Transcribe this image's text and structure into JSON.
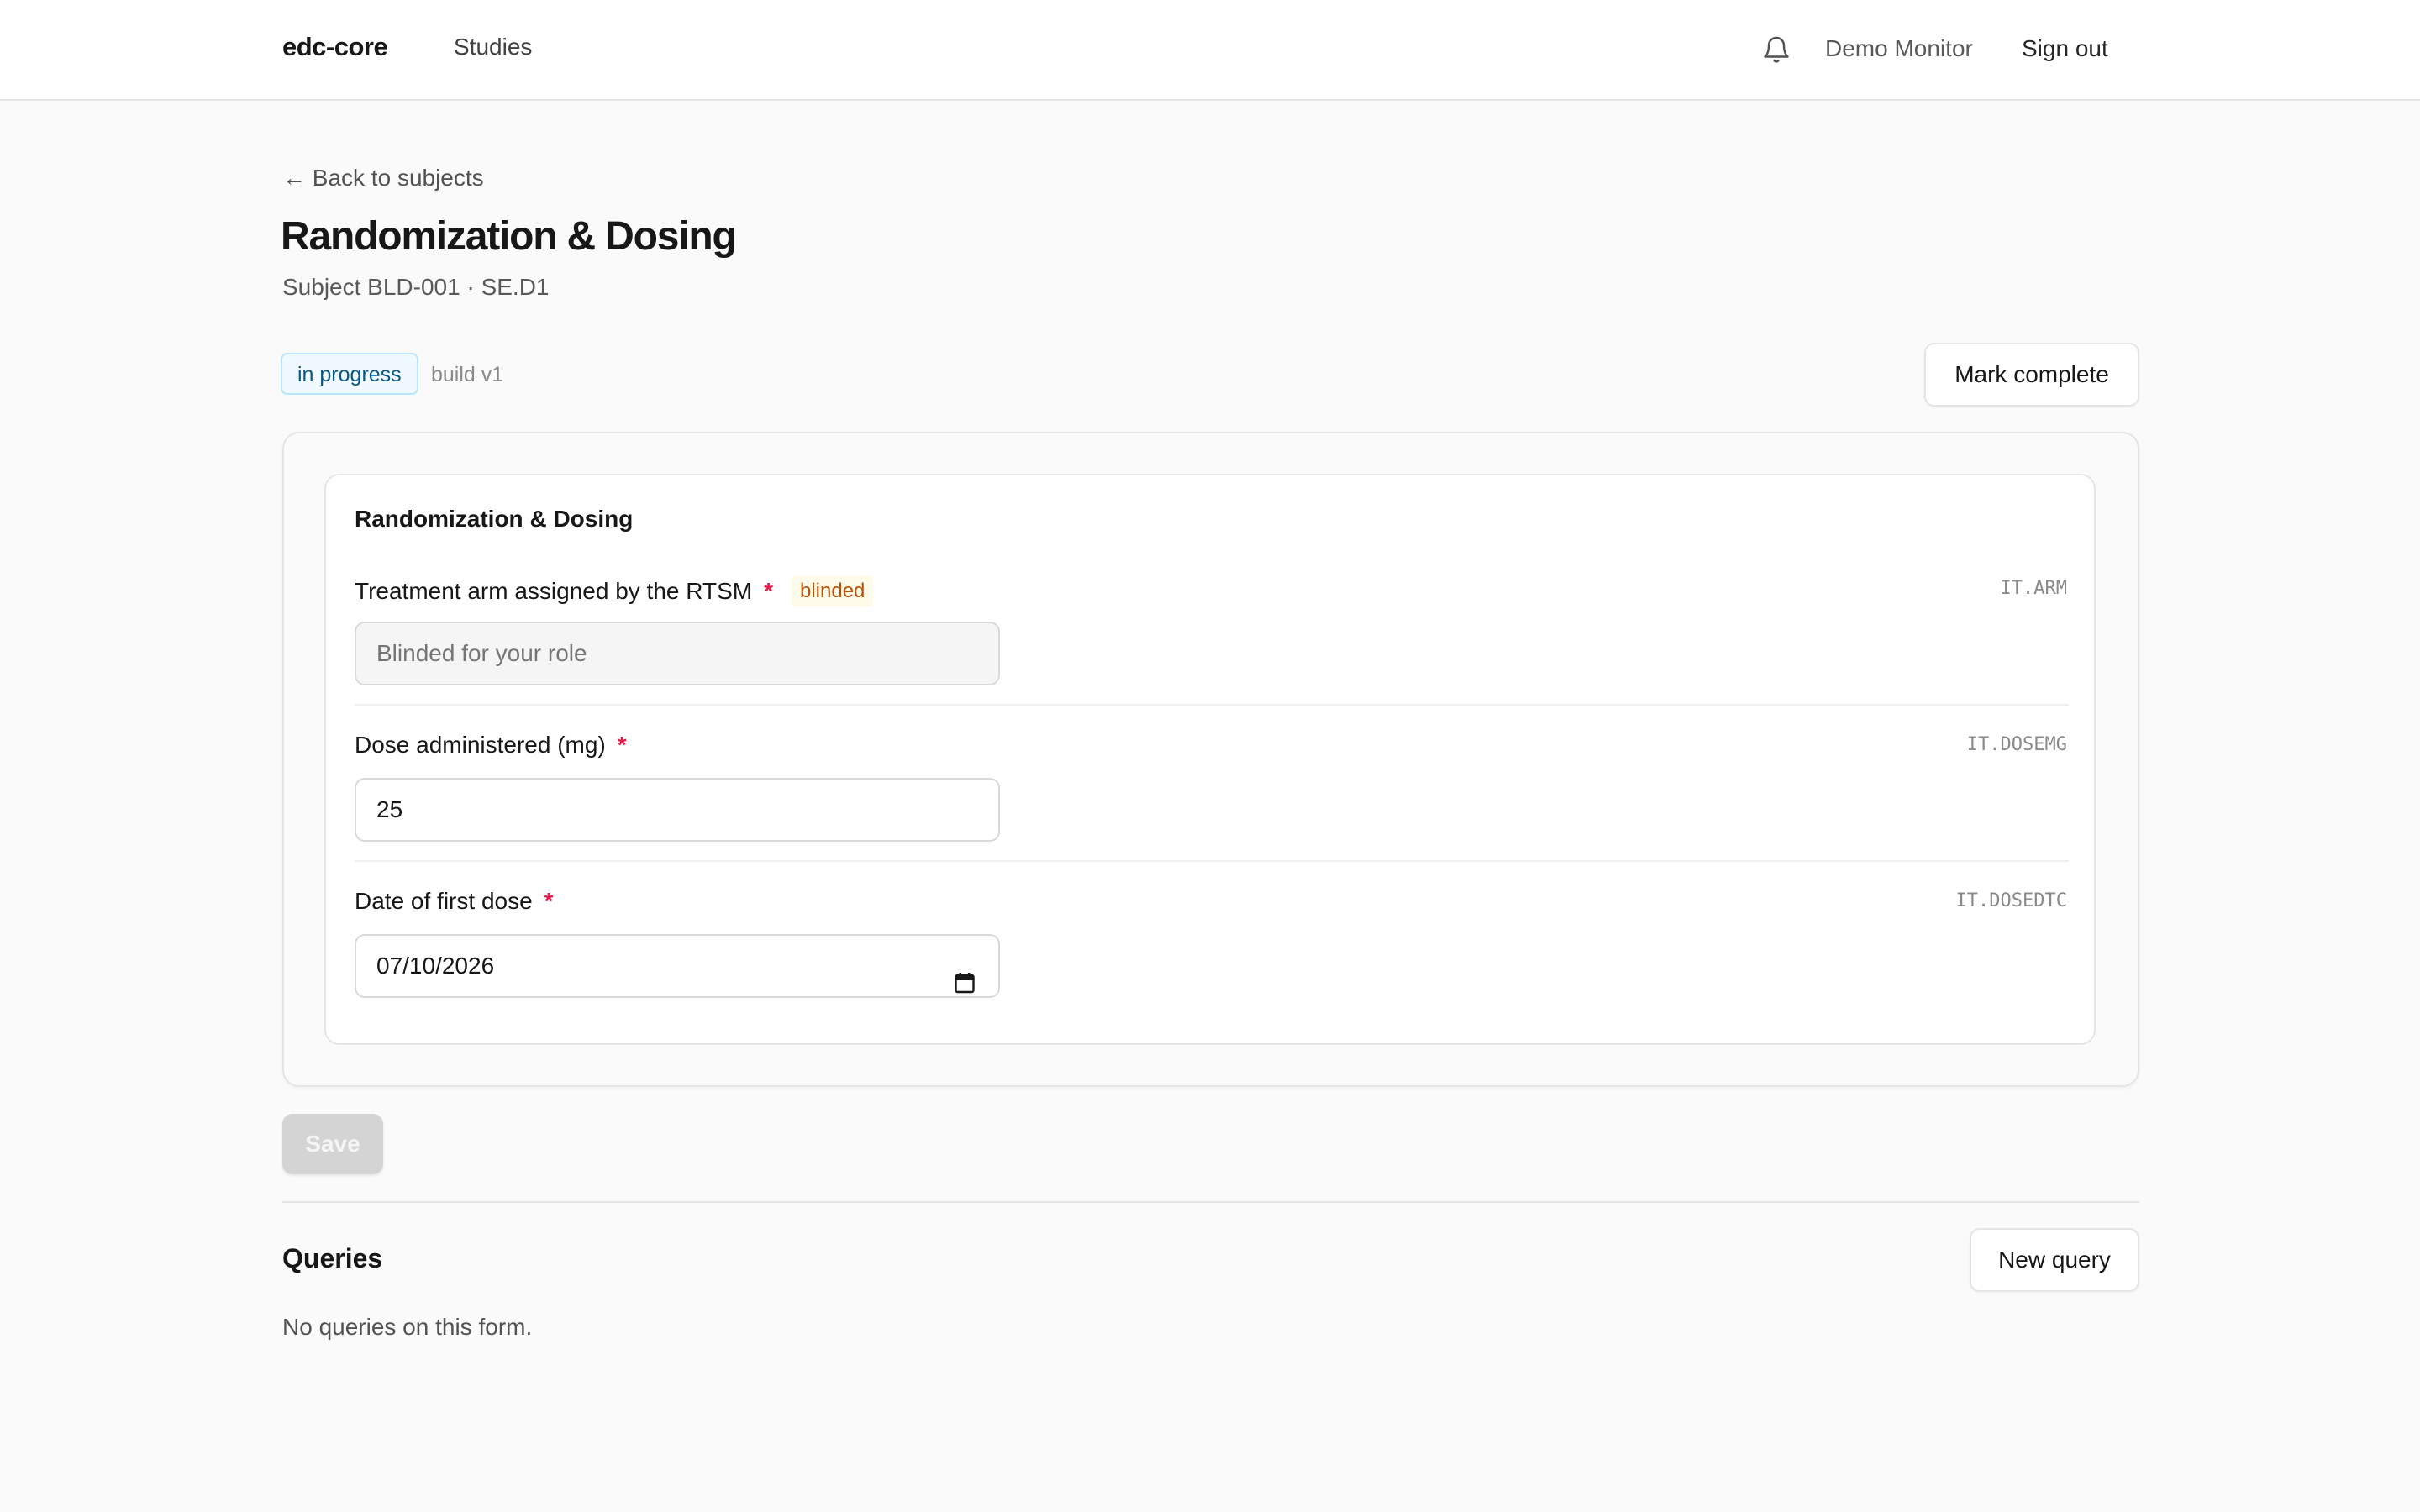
{
  "header": {
    "brand": "edc-core",
    "nav_studies": "Studies",
    "user_name": "Demo Monitor",
    "sign_out": "Sign out",
    "notification_icon": "bell-icon"
  },
  "page": {
    "back_link": "← Back to subjects",
    "title": "Randomization & Dosing",
    "subtitle": "Subject BLD-001 · SE.D1",
    "status": "in progress",
    "build": "build v1",
    "mark_complete": "Mark complete"
  },
  "form": {
    "section_title": "Randomization & Dosing",
    "fields": [
      {
        "label": "Treatment arm assigned by the RTSM",
        "required": "*",
        "badge": "blinded",
        "code": "IT.ARM",
        "value": "",
        "placeholder": "Blinded for your role",
        "disabled": true
      },
      {
        "label": "Dose administered (mg)",
        "required": "*",
        "code": "IT.DOSEMG",
        "value": "25"
      },
      {
        "label": "Date of first dose",
        "required": "*",
        "code": "IT.DOSEDTC",
        "value": "07/10/2026",
        "calendar_icon": "calendar-icon"
      }
    ]
  },
  "actions": {
    "save": "Save"
  },
  "queries": {
    "title": "Queries",
    "new_query": "New query",
    "empty_message": "No queries on this form."
  },
  "colors": {
    "required": "#e11d48",
    "status_badge_bg": "#f0f9ff",
    "status_badge_text": "#075985",
    "blinded_badge_bg": "#fffbeb",
    "blinded_badge_text": "#b45309"
  }
}
